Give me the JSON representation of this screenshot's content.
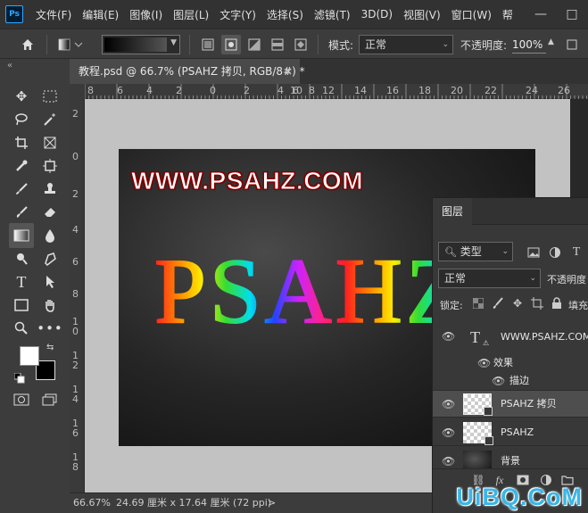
{
  "menubar": {
    "logo": "Ps",
    "items": [
      "文件(F)",
      "编辑(E)",
      "图像(I)",
      "图层(L)",
      "文字(Y)",
      "选择(S)",
      "滤镜(T)",
      "3D(D)",
      "视图(V)",
      "窗口(W)",
      "帮"
    ],
    "minimize": "—",
    "restore": "□"
  },
  "options": {
    "mode_label": "模式:",
    "mode_value": "正常",
    "opacity_label": "不透明度:",
    "opacity_value": "100%"
  },
  "tab": {
    "title": "教程.psd @ 66.7% (PSAHZ 拷贝, RGB/8#) *",
    "close": "×"
  },
  "ruler_h": [
    "8",
    "6",
    "4",
    "2",
    "0",
    "2",
    "4",
    "6",
    "8",
    "10",
    "12",
    "14",
    "16",
    "18",
    "20",
    "22",
    "24",
    "26"
  ],
  "ruler_v": [
    "2",
    "0",
    "2",
    "4",
    "6",
    "8",
    "1 0",
    "1 2",
    "1 4",
    "1 6",
    "1 8"
  ],
  "canvas": {
    "url_text": "WWW.PSAHZ.COM",
    "main_text": "PSAHZ"
  },
  "status": {
    "zoom": "66.67%",
    "doc_size": "24.69 厘米 x 17.64 厘米 (72 ppi)",
    "arrow": ">"
  },
  "layers": {
    "tab": "图层",
    "filter_label": "类型",
    "blend_mode": "正常",
    "opacity_label": "不透明度",
    "lock_label": "锁定:",
    "fill_label": "填充",
    "rows": [
      {
        "name": "WWW.PSAHZ.COM"
      },
      {
        "name": "效果"
      },
      {
        "name": "描边"
      },
      {
        "name": "PSAHZ 拷贝"
      },
      {
        "name": "PSAHZ"
      },
      {
        "name": "背景"
      }
    ]
  },
  "watermark": "UiBQ.CoM",
  "colors": {
    "accent": "#31a8ff",
    "watermark": "#38b7e8"
  }
}
